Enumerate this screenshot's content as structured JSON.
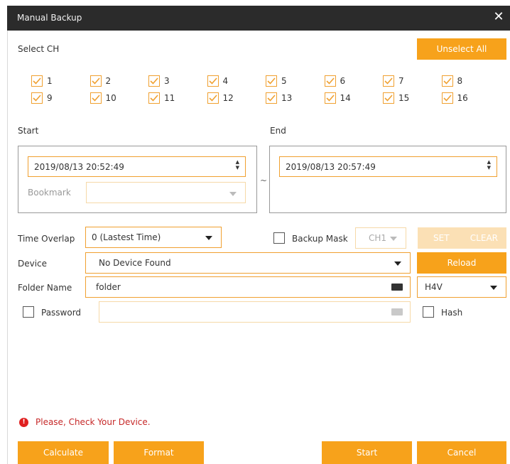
{
  "window": {
    "title": "Manual Backup",
    "close_glyph": "✕"
  },
  "select_ch": {
    "label": "Select CH",
    "unselect_all_label": "Unselect All",
    "channels": [
      "1",
      "2",
      "3",
      "4",
      "5",
      "6",
      "7",
      "8",
      "9",
      "10",
      "11",
      "12",
      "13",
      "14",
      "15",
      "16"
    ]
  },
  "start": {
    "label": "Start",
    "value": "2019/08/13  20:52:49",
    "bookmark_label": "Bookmark",
    "bookmark_value": ""
  },
  "range_separator": "~",
  "end": {
    "label": "End",
    "value": "2019/08/13  20:57:49"
  },
  "time_overlap": {
    "label": "Time Overlap",
    "value": "0 (Lastest Time)"
  },
  "backup_mask": {
    "label": "Backup Mask",
    "checked": false,
    "channel_value": "CH1",
    "set_label": "SET",
    "clear_label": "CLEAR"
  },
  "device": {
    "label": "Device",
    "value": "No Device Found",
    "reload_label": "Reload"
  },
  "folder": {
    "label": "Folder Name",
    "value": "folder",
    "format_value": "H4V"
  },
  "password": {
    "label": "Password",
    "checked": false,
    "value": "",
    "hash_label": "Hash",
    "hash_checked": false
  },
  "message": {
    "text": "Please, Check Your Device.",
    "icon": "error-icon",
    "icon_glyph": "!"
  },
  "footer": {
    "calculate_label": "Calculate",
    "format_label": "Format",
    "start_label": "Start",
    "cancel_label": "Cancel"
  },
  "colors": {
    "accent": "#f7a21b",
    "accent_light": "#fbe0b5",
    "title_bar": "#2b2b2b",
    "error": "#e02020"
  }
}
